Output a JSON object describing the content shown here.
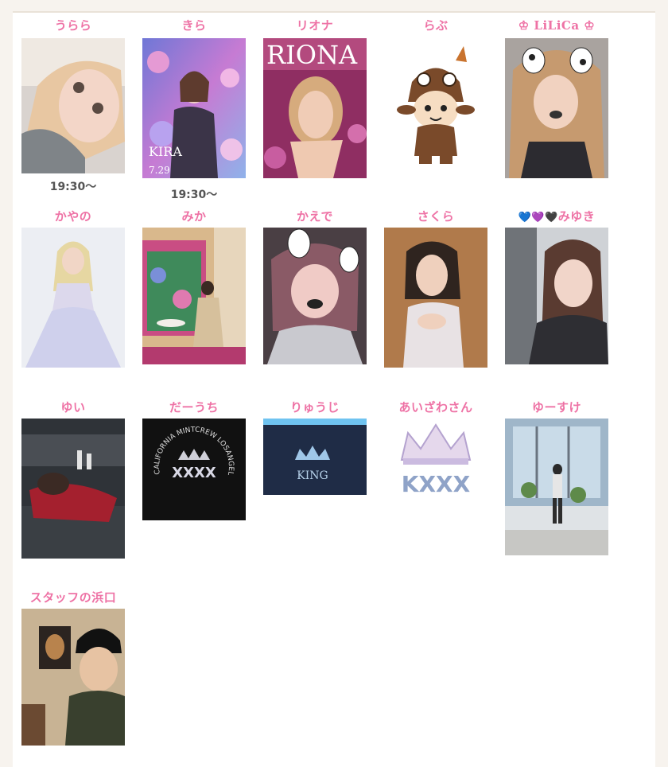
{
  "cast": [
    {
      "name": "うらら",
      "time": "19:30〜"
    },
    {
      "name": "きら",
      "time": "19:30〜",
      "poster_text": "KIRA",
      "poster_date": "7.29"
    },
    {
      "name": "リオナ",
      "poster_text": "RIONA"
    },
    {
      "name": "らぶ"
    },
    {
      "name": "♔ LiLiCa ♔"
    },
    {
      "name": "かやの"
    },
    {
      "name": "みか"
    },
    {
      "name": "かえで"
    },
    {
      "name": "さくら"
    },
    {
      "name": "みゆき",
      "hearts": [
        "💙",
        "💜",
        "🖤"
      ]
    },
    {
      "name": "ゆい"
    },
    {
      "name": "だーうち",
      "shirt_text": "XXXX",
      "shirt_arc": "CALIFORNIA MINTCREW LOSANGELES"
    },
    {
      "name": "りゅうじ",
      "logo_text": "KING"
    },
    {
      "name": "あいざわさん",
      "logo_text": "KXXX"
    },
    {
      "name": "ゆーすけ"
    },
    {
      "name": "スタッフの浜口"
    }
  ]
}
